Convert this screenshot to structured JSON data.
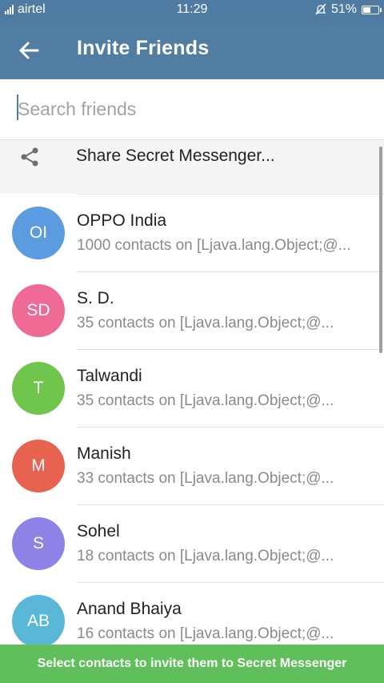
{
  "status_bar": {
    "carrier": "airtel",
    "time": "11:29",
    "battery_percent": "51%",
    "battery_level": 0.51,
    "icons": [
      "signal-icon",
      "bell-off-icon",
      "battery-icon"
    ]
  },
  "header": {
    "title": "Invite Friends",
    "back_icon": "arrow-left-icon",
    "color": "#527da3"
  },
  "search": {
    "placeholder": "Search friends",
    "value": ""
  },
  "share": {
    "icon": "share-icon",
    "label": "Share Secret Messenger..."
  },
  "contacts": [
    {
      "initials": "OI",
      "name": "OPPO India",
      "subtitle": "1000 contacts on [Ljava.lang.Object;@...",
      "color": "#5b9be0"
    },
    {
      "initials": "SD",
      "name": "S. D.",
      "subtitle": "35 contacts on [Ljava.lang.Object;@...",
      "color": "#ef6b96"
    },
    {
      "initials": "T",
      "name": "Talwandi",
      "subtitle": "35 contacts on [Ljava.lang.Object;@...",
      "color": "#70c64d"
    },
    {
      "initials": "M",
      "name": "Manish",
      "subtitle": "33 contacts on [Ljava.lang.Object;@...",
      "color": "#e8634f"
    },
    {
      "initials": "S",
      "name": "Sohel",
      "subtitle": "18 contacts on [Ljava.lang.Object;@...",
      "color": "#8e82e6"
    },
    {
      "initials": "AB",
      "name": "Anand Bhaiya",
      "subtitle": "16 contacts on [Ljava.lang.Object;@...",
      "color": "#5ab7d8"
    }
  ],
  "bottom_bar": {
    "label": "Select contacts to invite them to Secret Messenger",
    "color": "#5fc05b"
  }
}
